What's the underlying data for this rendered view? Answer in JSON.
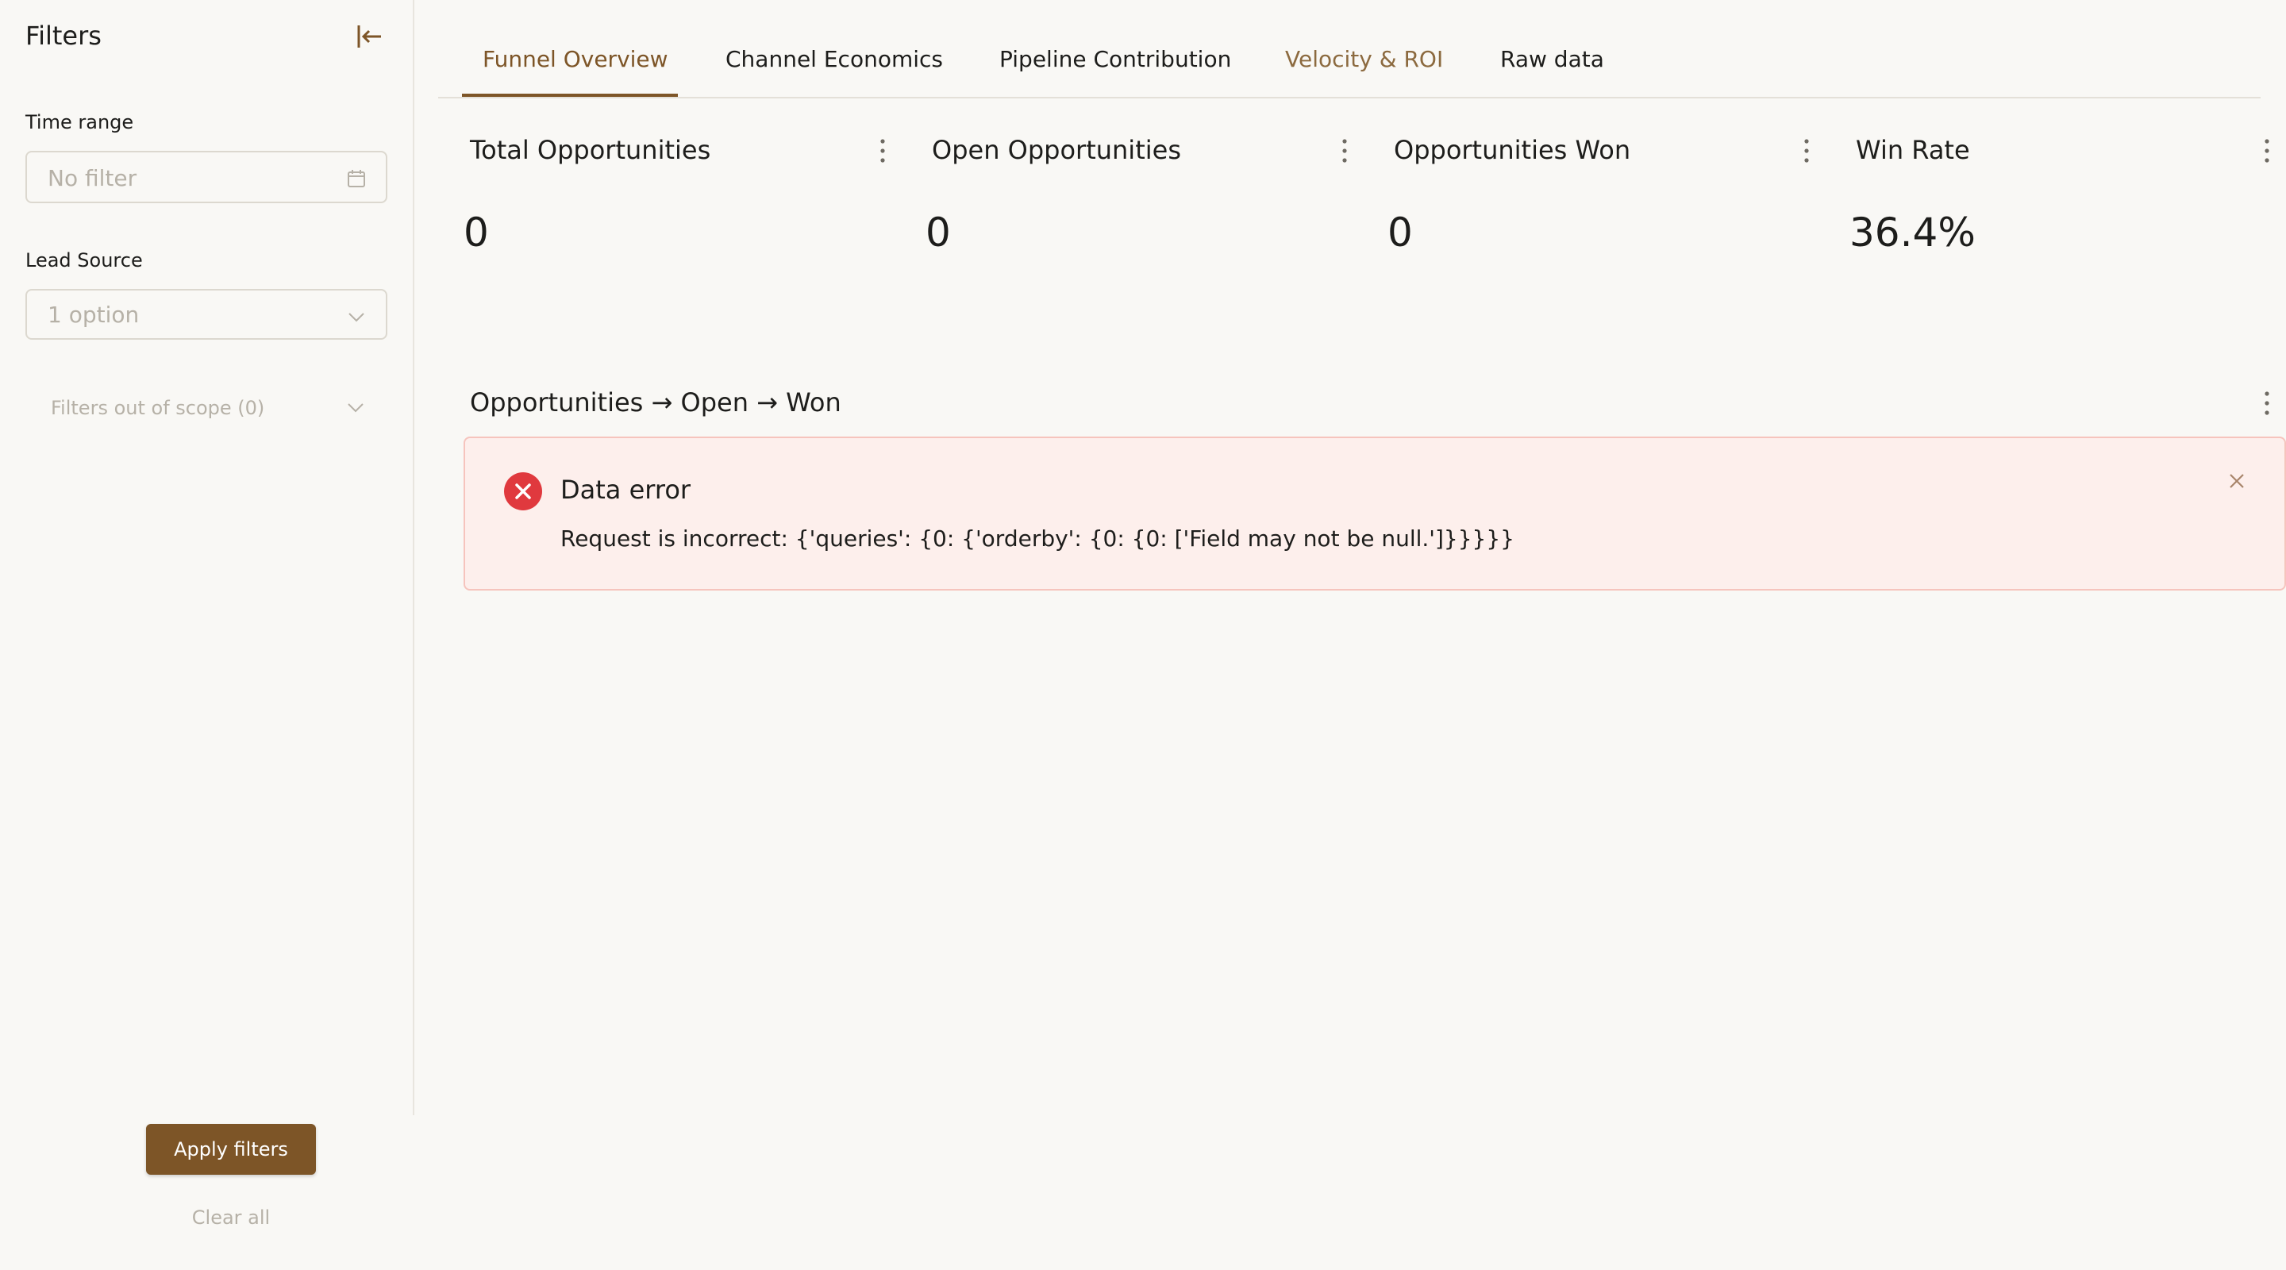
{
  "sidebar": {
    "title": "Filters",
    "collapse_icon": "collapse-left-icon",
    "time_range": {
      "label": "Time range",
      "placeholder": "No filter",
      "icon": "calendar-icon"
    },
    "lead_source": {
      "label": "Lead Source",
      "placeholder": "1 option",
      "icon": "chevron-down-icon"
    },
    "out_of_scope": "Filters out of scope (0)",
    "apply_label": "Apply filters",
    "clear_label": "Clear all"
  },
  "tabs": [
    {
      "label": "Funnel Overview",
      "active": true
    },
    {
      "label": "Channel Economics"
    },
    {
      "label": "Pipeline Contribution"
    },
    {
      "label": "Velocity & ROI"
    },
    {
      "label": "Raw data"
    }
  ],
  "kpis": [
    {
      "title": "Total Opportunities",
      "value": "0"
    },
    {
      "title": "Open Opportunities",
      "value": "0"
    },
    {
      "title": "Opportunities Won",
      "value": "0"
    },
    {
      "title": "Win Rate",
      "value": "36.4%"
    }
  ],
  "chart": {
    "title": "Opportunities → Open → Won",
    "error": {
      "title": "Data error",
      "message": "Request is incorrect: {'queries': {0: {'orderby': {0: {0: ['Field may not be null.']}}}}}",
      "icon": "error-circle-icon"
    }
  },
  "colors": {
    "accent": "#7d5527",
    "background": "#f9f8f5",
    "error_bg": "#fdefec",
    "error_icon": "#e0393e"
  }
}
